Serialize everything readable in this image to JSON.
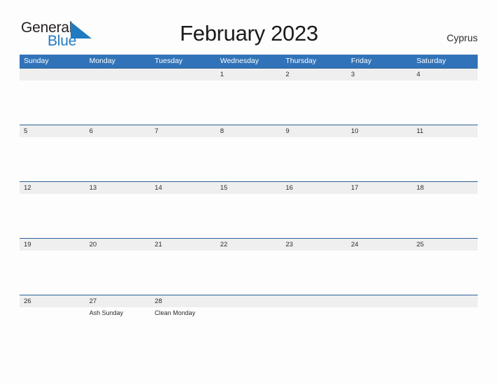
{
  "brand": {
    "word_one": "General",
    "word_two": "Blue",
    "flag_icon": "blue-triangle-flag-icon",
    "primary_color": "#1f7ac0",
    "text_color": "#231f20"
  },
  "header": {
    "title": "February 2023",
    "locale": "Cyprus"
  },
  "colors": {
    "weekday_header_bg": "#3173b8",
    "weekday_header_text": "#ffffff",
    "date_band_bg": "#efefef",
    "row_border": "#2a6296",
    "page_bg": "#fdfdfd",
    "body_text": "#2b2b2b"
  },
  "calendar": {
    "month": "February",
    "year": "2023",
    "weekdays": [
      "Sunday",
      "Monday",
      "Tuesday",
      "Wednesday",
      "Thursday",
      "Friday",
      "Saturday"
    ],
    "weeks": [
      {
        "days": [
          {
            "date": "",
            "event": ""
          },
          {
            "date": "",
            "event": ""
          },
          {
            "date": "",
            "event": ""
          },
          {
            "date": "1",
            "event": ""
          },
          {
            "date": "2",
            "event": ""
          },
          {
            "date": "3",
            "event": ""
          },
          {
            "date": "4",
            "event": ""
          }
        ]
      },
      {
        "days": [
          {
            "date": "5",
            "event": ""
          },
          {
            "date": "6",
            "event": ""
          },
          {
            "date": "7",
            "event": ""
          },
          {
            "date": "8",
            "event": ""
          },
          {
            "date": "9",
            "event": ""
          },
          {
            "date": "10",
            "event": ""
          },
          {
            "date": "11",
            "event": ""
          }
        ]
      },
      {
        "days": [
          {
            "date": "12",
            "event": ""
          },
          {
            "date": "13",
            "event": ""
          },
          {
            "date": "14",
            "event": ""
          },
          {
            "date": "15",
            "event": ""
          },
          {
            "date": "16",
            "event": ""
          },
          {
            "date": "17",
            "event": ""
          },
          {
            "date": "18",
            "event": ""
          }
        ]
      },
      {
        "days": [
          {
            "date": "19",
            "event": ""
          },
          {
            "date": "20",
            "event": ""
          },
          {
            "date": "21",
            "event": ""
          },
          {
            "date": "22",
            "event": ""
          },
          {
            "date": "23",
            "event": ""
          },
          {
            "date": "24",
            "event": ""
          },
          {
            "date": "25",
            "event": ""
          }
        ]
      },
      {
        "days": [
          {
            "date": "26",
            "event": ""
          },
          {
            "date": "27",
            "event": "Ash Sunday"
          },
          {
            "date": "28",
            "event": "Clean Monday"
          },
          {
            "date": "",
            "event": ""
          },
          {
            "date": "",
            "event": ""
          },
          {
            "date": "",
            "event": ""
          },
          {
            "date": "",
            "event": ""
          }
        ]
      }
    ]
  }
}
